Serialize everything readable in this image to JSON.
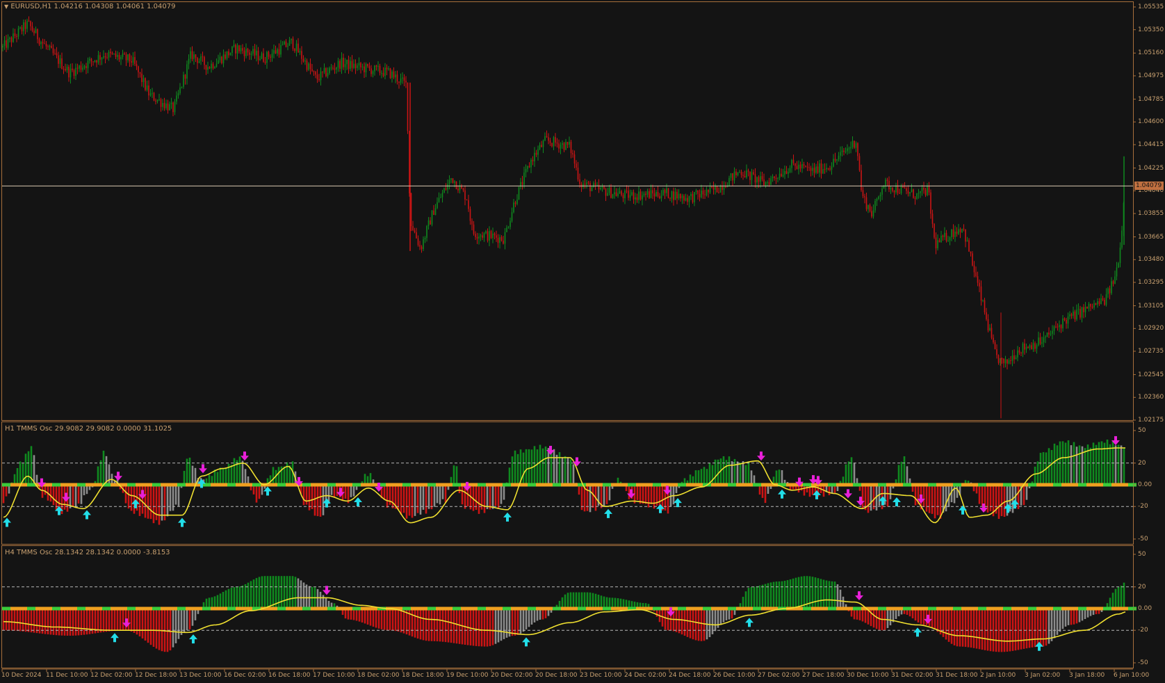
{
  "colors": {
    "bg": "#141414",
    "border": "#a8703c",
    "text": "#c8a070",
    "bull": "#0f8a1f",
    "bear": "#cc1414",
    "gray": "#8c8c8c",
    "signal": "#f0e030",
    "zero_orange": "#f0a020",
    "zero_green": "#3acc3a",
    "arrow_up": "#22dde8",
    "arrow_down": "#e820d8",
    "price_line": "#d8c8b0",
    "price_tag": "#c07040"
  },
  "main": {
    "title": "EURUSD,H1  1.04216 1.04308 1.04061 1.04079",
    "current_price": "1.04079",
    "price_ticks": [
      "1.05535",
      "1.05350",
      "1.05160",
      "1.04975",
      "1.04785",
      "1.04600",
      "1.04415",
      "1.04225",
      "1.04040",
      "1.03855",
      "1.03665",
      "1.03480",
      "1.03295",
      "1.03105",
      "1.02920",
      "1.02735",
      "1.02545",
      "1.02360",
      "1.02175"
    ]
  },
  "osc1": {
    "title": "H1 TMMS Osc 29.9082 29.9082 0.0000 31.1025",
    "ticks": [
      "50",
      "20",
      "0.00",
      "-20",
      "-50"
    ]
  },
  "osc2": {
    "title": "H4 TMMS Osc 28.1342 28.1342 0.0000 -3.8153",
    "ticks": [
      "50",
      "20",
      "0.00",
      "-20",
      "-50"
    ]
  },
  "time_ticks": [
    "10 Dec 2024",
    "11 Dec 10:00",
    "12 Dec 02:00",
    "12 Dec 18:00",
    "13 Dec 10:00",
    "16 Dec 02:00",
    "16 Dec 18:00",
    "17 Dec 10:00",
    "18 Dec 02:00",
    "18 Dec 18:00",
    "19 Dec 10:00",
    "20 Dec 02:00",
    "20 Dec 18:00",
    "23 Dec 10:00",
    "24 Dec 02:00",
    "24 Dec 18:00",
    "26 Dec 10:00",
    "27 Dec 02:00",
    "27 Dec 18:00",
    "30 Dec 10:00",
    "31 Dec 02:00",
    "31 Dec 18:00",
    "2 Jan 10:00",
    "3 Jan 02:00",
    "3 Jan 18:00",
    "6 Jan 10:00"
  ]
}
